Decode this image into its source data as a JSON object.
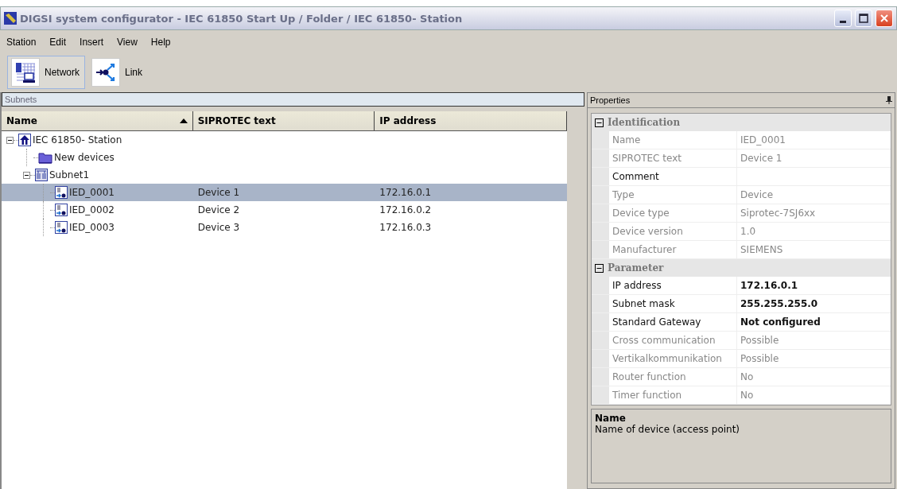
{
  "window": {
    "title": "DIGSI system configurator - IEC 61850 Start Up / Folder / IEC 61850- Station"
  },
  "menu": [
    "Station",
    "Edit",
    "Insert",
    "View",
    "Help"
  ],
  "toolbar": [
    {
      "label": "Network",
      "kind": "network",
      "selected": true
    },
    {
      "label": "Link",
      "kind": "link",
      "selected": false
    }
  ],
  "subnets": {
    "title": "Subnets",
    "columns": [
      {
        "label": "Name",
        "sorted": true
      },
      {
        "label": "SIPROTEC text",
        "sorted": false
      },
      {
        "label": "IP address",
        "sorted": false
      }
    ],
    "tree": [
      {
        "name": "IEC 61850- Station",
        "kind": "station",
        "expanded": true,
        "selected": false,
        "children": [
          {
            "name": "New devices",
            "kind": "folder",
            "selected": false
          },
          {
            "name": "Subnet1",
            "kind": "subnet",
            "expanded": true,
            "selected": false,
            "children": [
              {
                "name": "IED_0001",
                "kind": "device",
                "text": "Device 1",
                "ip": "172.16.0.1",
                "selected": true
              },
              {
                "name": "IED_0002",
                "kind": "device",
                "text": "Device 2",
                "ip": "172.16.0.2",
                "selected": false
              },
              {
                "name": "IED_0003",
                "kind": "device",
                "text": "Device 3",
                "ip": "172.16.0.3",
                "selected": false
              }
            ]
          }
        ]
      }
    ]
  },
  "properties": {
    "title": "Properties",
    "groups": [
      {
        "name": "Identification",
        "expanded": true,
        "rows": [
          {
            "label": "Name",
            "value": "IED_0001",
            "disabled": true
          },
          {
            "label": "SIPROTEC text",
            "value": "Device 1",
            "disabled": true
          },
          {
            "label": "Comment",
            "disabled": false
          },
          {
            "label": "Type",
            "value": "Device",
            "disabled": true
          },
          {
            "label": "Device type",
            "value": "Siprotec-7SJ6xx",
            "disabled": true
          },
          {
            "label": "Device version",
            "value": "1.0",
            "disabled": true
          },
          {
            "label": "Manufacturer",
            "value": "SIEMENS",
            "disabled": true
          }
        ]
      },
      {
        "name": "Parameter",
        "expanded": true,
        "rows": [
          {
            "label": "IP address",
            "value": "172.16.0.1",
            "disabled": false,
            "emphasized": true
          },
          {
            "label": "Subnet mask",
            "value": "255.255.255.0",
            "disabled": false,
            "emphasized": true
          },
          {
            "label": "Standard Gateway",
            "value": "Not configured",
            "disabled": false,
            "emphasized": true
          },
          {
            "label": "Cross communication",
            "value": "Possible",
            "disabled": true
          },
          {
            "label": "Vertikalkommunikation",
            "value": "Possible",
            "disabled": true
          },
          {
            "label": "Router function",
            "value": "No",
            "disabled": true
          },
          {
            "label": "Timer function",
            "value": "No",
            "disabled": true
          }
        ]
      }
    ],
    "help": {
      "title": "Name",
      "text": "Name of device (access point)"
    }
  }
}
